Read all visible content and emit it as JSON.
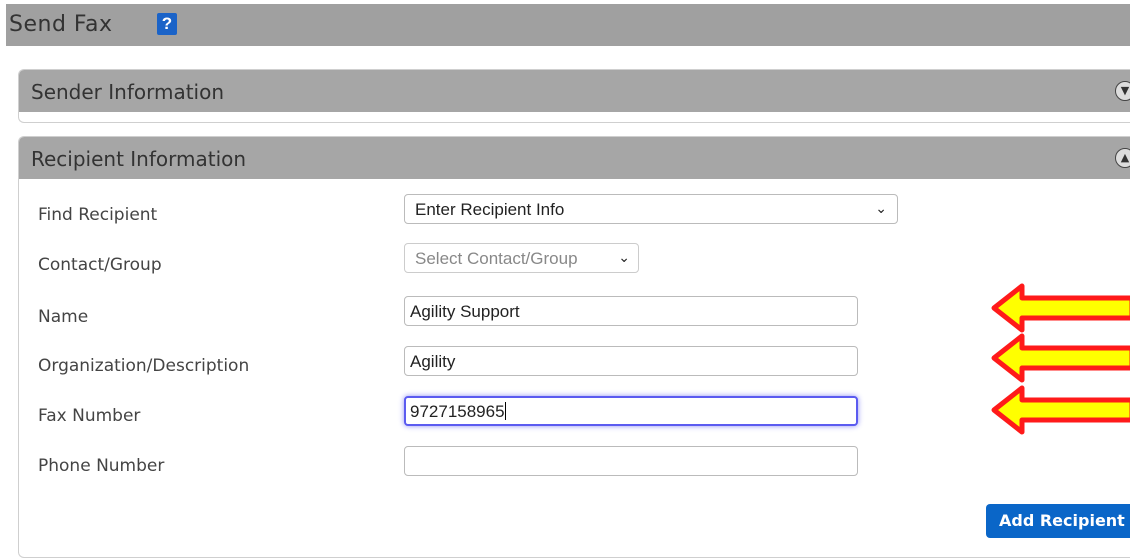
{
  "header": {
    "title": "Send Fax",
    "help_icon": "help-icon"
  },
  "sender_panel": {
    "title": "Sender Information",
    "toggle_icon": "chevron-down-circle-icon"
  },
  "recipient_panel": {
    "title": "Recipient Information",
    "toggle_icon": "chevron-up-circle-icon",
    "fields": {
      "find_recipient": {
        "label": "Find Recipient",
        "value": "Enter Recipient Info"
      },
      "contact_group": {
        "label": "Contact/Group",
        "value": "Select Contact/Group"
      },
      "name": {
        "label": "Name",
        "value": "Agility Support"
      },
      "organization": {
        "label": "Organization/Description",
        "value": "Agility"
      },
      "fax_number": {
        "label": "Fax Number",
        "value": "9727158965"
      },
      "phone_number": {
        "label": "Phone Number",
        "value": ""
      }
    },
    "add_button": "Add Recipient"
  },
  "annotations": {
    "arrow_colors": {
      "fill": "#ffff00",
      "outline": "#ff0000"
    }
  }
}
